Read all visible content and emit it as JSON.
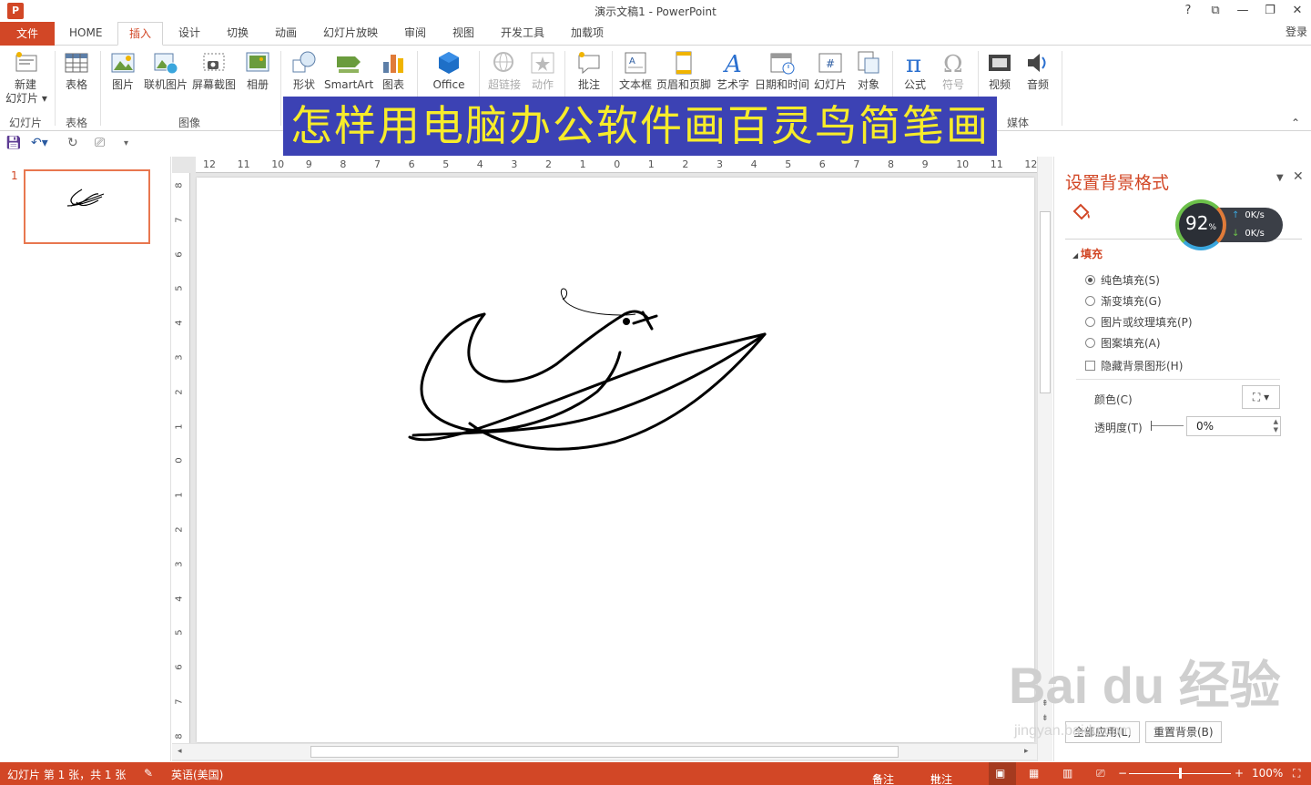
{
  "window": {
    "title": "演示文稿1 - PowerPoint",
    "logo_text": "P",
    "controls": [
      "?",
      "⧉",
      "—",
      "❐",
      "✕"
    ]
  },
  "tabs": {
    "file": "文件",
    "items": [
      "HOME",
      "插入",
      "设计",
      "切换",
      "动画",
      "幻灯片放映",
      "审阅",
      "视图",
      "开发工具",
      "加载项"
    ],
    "active": "插入",
    "login": "登录"
  },
  "ribbon": {
    "buttons": {
      "new_slide": "新建\n幻灯片 ▾",
      "table": "表格",
      "picture": "图片",
      "online_picture": "联机图片",
      "screenshot": "屏幕截图",
      "album": "相册",
      "shapes": "形状",
      "smartart": "SmartArt",
      "chart": "图表",
      "office": "Office",
      "hyperlink": "超链接",
      "action": "动作",
      "comment": "批注",
      "textbox": "文本框",
      "header_footer": "页眉和页脚",
      "wordart": "艺术字",
      "datetime": "日期和时间",
      "slide_number": "幻灯片",
      "object": "对象",
      "equation": "公式",
      "symbol": "符号",
      "video": "视频",
      "audio": "音频"
    },
    "groups": {
      "slides": "幻灯片",
      "tables": "表格",
      "images": "图像",
      "media": "媒体"
    }
  },
  "banner": "怎样用电脑办公软件画百灵鸟简笔画",
  "thumbnails": {
    "number": "1"
  },
  "ruler": {
    "h": [
      "12",
      "11",
      "10",
      "9",
      "8",
      "7",
      "6",
      "5",
      "4",
      "3",
      "2",
      "1",
      "0",
      "1",
      "2",
      "3",
      "4",
      "5",
      "6",
      "7",
      "8",
      "9",
      "10",
      "11",
      "12"
    ],
    "v": [
      "8",
      "7",
      "6",
      "5",
      "4",
      "3",
      "2",
      "1",
      "0",
      "1",
      "2",
      "3",
      "4",
      "5",
      "6",
      "7",
      "8"
    ]
  },
  "pane": {
    "title": "设置背景格式",
    "section": "填充",
    "options": [
      "纯色填充(S)",
      "渐变填充(G)",
      "图片或纹理填充(P)",
      "图案填充(A)"
    ],
    "selected_index": 0,
    "hide_bg": "隐藏背景图形(H)",
    "color_label": "颜色(C)",
    "transparency_label": "透明度(T)",
    "transparency_value": "0%",
    "apply_all": "全部应用(L)",
    "reset_bg": "重置背景(B)"
  },
  "speed": {
    "percent": "92",
    "percent_sign": "%",
    "up": "0K/s",
    "down": "0K/s"
  },
  "watermark": {
    "main": "Bai du 经验",
    "sub": "jingyan.baidu.com"
  },
  "status": {
    "slide_info": "幻灯片 第 1 张，共 1 张",
    "language": "英语(美国)",
    "notes": "备注",
    "comments": "批注",
    "zoom": "100%"
  },
  "colors": {
    "accent": "#d24726",
    "banner_bg": "#3c42b4",
    "banner_text": "#f7ec2a"
  }
}
